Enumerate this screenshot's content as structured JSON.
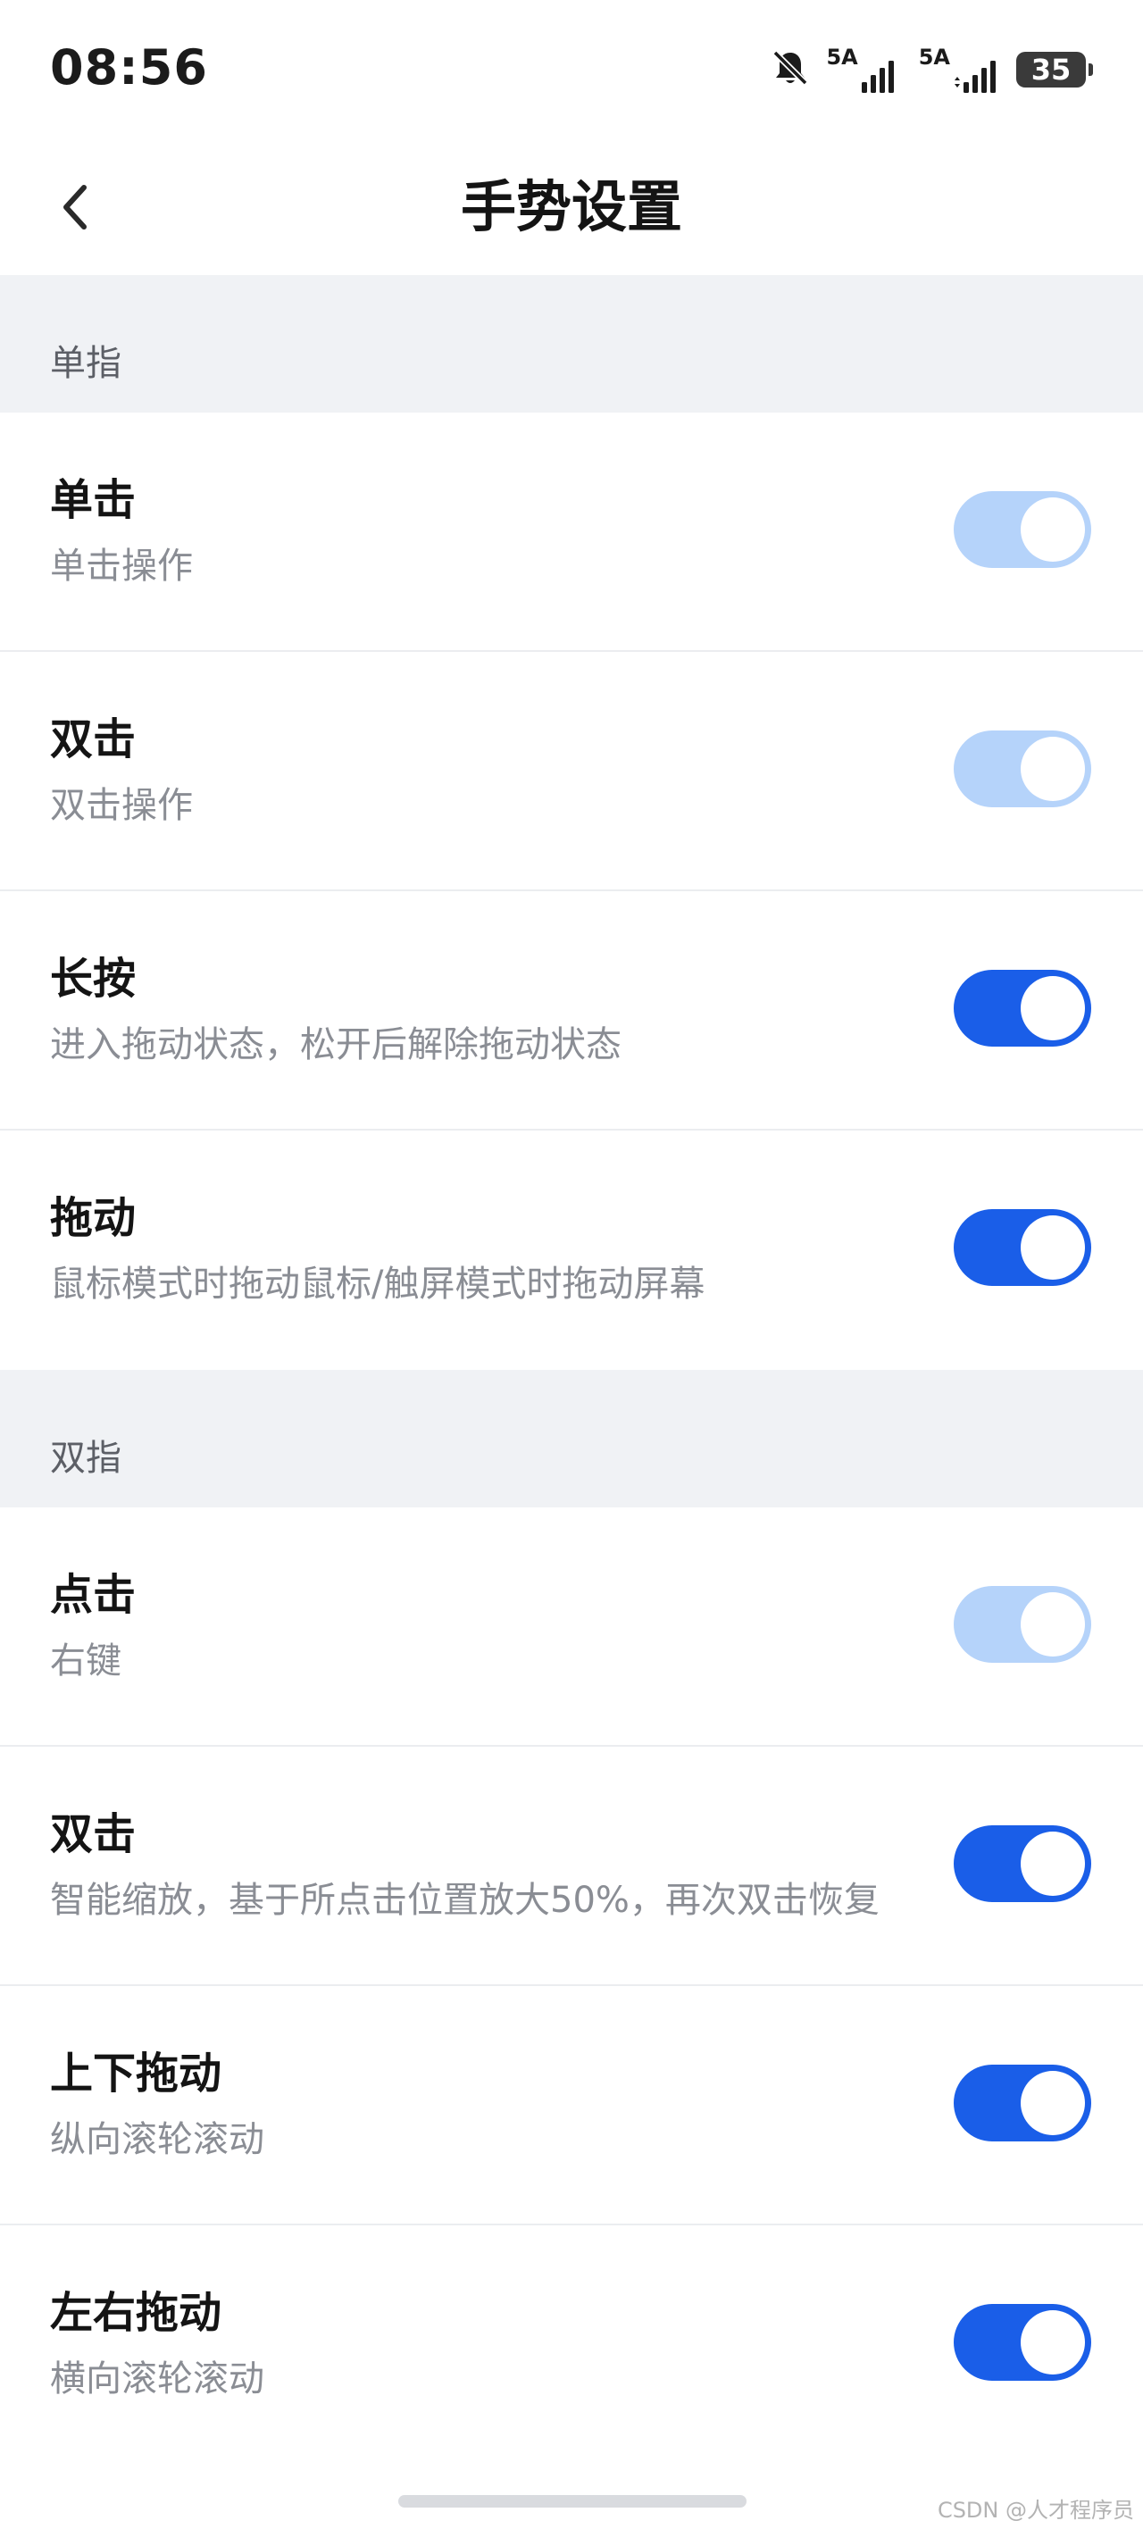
{
  "status_bar": {
    "time": "08:56",
    "signal1_label": "5A",
    "signal2_label": "5A",
    "battery": "35"
  },
  "header": {
    "title": "手势设置"
  },
  "sections": [
    {
      "label": "单指",
      "rows": [
        {
          "title": "单击",
          "desc": "单击操作",
          "state": "disabled"
        },
        {
          "title": "双击",
          "desc": "双击操作",
          "state": "disabled"
        },
        {
          "title": "长按",
          "desc": "进入拖动状态，松开后解除拖动状态",
          "state": "on"
        },
        {
          "title": "拖动",
          "desc": "鼠标模式时拖动鼠标/触屏模式时拖动屏幕",
          "state": "on"
        }
      ]
    },
    {
      "label": "双指",
      "rows": [
        {
          "title": "点击",
          "desc": "右键",
          "state": "disabled"
        },
        {
          "title": "双击",
          "desc": "智能缩放，基于所点击位置放大50%，再次双击恢复",
          "state": "on"
        },
        {
          "title": "上下拖动",
          "desc": "纵向滚轮滚动",
          "state": "on"
        },
        {
          "title": "左右拖动",
          "desc": "横向滚轮滚动",
          "state": "on"
        }
      ]
    }
  ],
  "colors": {
    "toggle_on": "#1a5ee8",
    "toggle_disabled": "#b5d3fa",
    "section_bg": "#f0f2f5"
  },
  "icons": {
    "back": "chevron-left-icon",
    "mute": "bell-off-icon",
    "signal": "signal-bars-icon",
    "battery": "battery-icon"
  },
  "watermark": "CSDN @人才程序员"
}
